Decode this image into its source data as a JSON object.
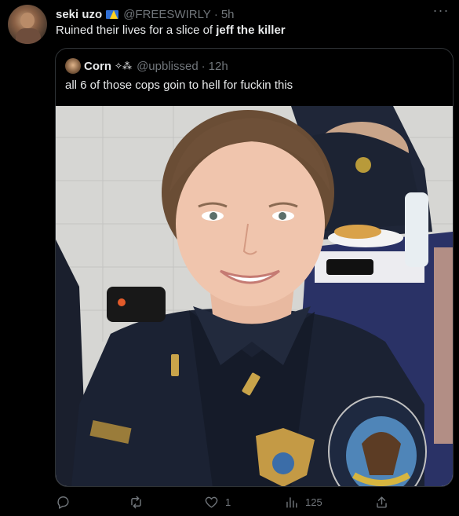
{
  "tweet": {
    "author": {
      "name": "seki uzo",
      "handle": "@FREESWIRLY",
      "time": "5h"
    },
    "text_before": "Ruined their lives for a slice of ",
    "text_bold": "jeff the killer",
    "more_label": "···"
  },
  "quoted": {
    "author": {
      "name": "Corn",
      "symbols": "✧⁂",
      "handle": "@upblissed",
      "time": "12h"
    },
    "text": "all 6 of those cops goin to hell for fuckin this",
    "media_icons": [
      "police-officer-photo"
    ]
  },
  "actions": {
    "reply_count": "",
    "retweet_count": "",
    "like_count": "1",
    "views_count": "125"
  },
  "icons": [
    "reply-icon",
    "retweet-icon",
    "like-icon",
    "views-icon",
    "share-icon",
    "more-icon"
  ],
  "colors": {
    "background": "#000000",
    "text": "#e7e9ea",
    "secondary": "#71767b",
    "border": "#2f3336"
  }
}
